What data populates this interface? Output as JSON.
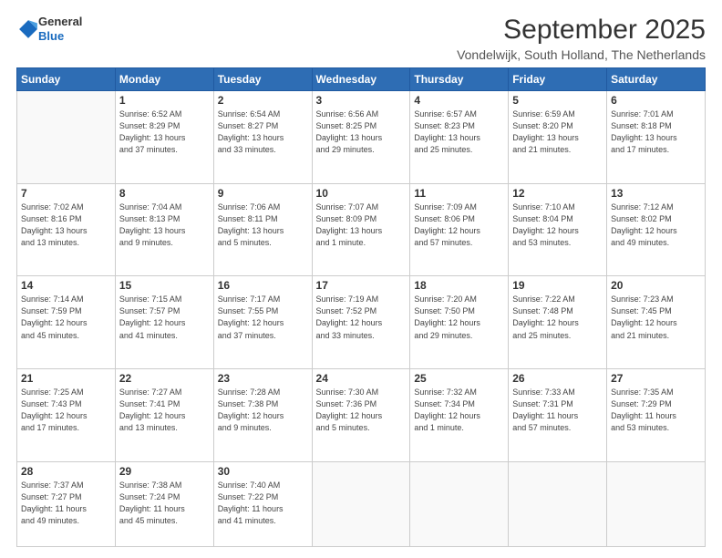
{
  "logo": {
    "general": "General",
    "blue": "Blue"
  },
  "header": {
    "month_year": "September 2025",
    "location": "Vondelwijk, South Holland, The Netherlands"
  },
  "days_of_week": [
    "Sunday",
    "Monday",
    "Tuesday",
    "Wednesday",
    "Thursday",
    "Friday",
    "Saturday"
  ],
  "weeks": [
    [
      {
        "day": "",
        "info": ""
      },
      {
        "day": "1",
        "info": "Sunrise: 6:52 AM\nSunset: 8:29 PM\nDaylight: 13 hours\nand 37 minutes."
      },
      {
        "day": "2",
        "info": "Sunrise: 6:54 AM\nSunset: 8:27 PM\nDaylight: 13 hours\nand 33 minutes."
      },
      {
        "day": "3",
        "info": "Sunrise: 6:56 AM\nSunset: 8:25 PM\nDaylight: 13 hours\nand 29 minutes."
      },
      {
        "day": "4",
        "info": "Sunrise: 6:57 AM\nSunset: 8:23 PM\nDaylight: 13 hours\nand 25 minutes."
      },
      {
        "day": "5",
        "info": "Sunrise: 6:59 AM\nSunset: 8:20 PM\nDaylight: 13 hours\nand 21 minutes."
      },
      {
        "day": "6",
        "info": "Sunrise: 7:01 AM\nSunset: 8:18 PM\nDaylight: 13 hours\nand 17 minutes."
      }
    ],
    [
      {
        "day": "7",
        "info": "Sunrise: 7:02 AM\nSunset: 8:16 PM\nDaylight: 13 hours\nand 13 minutes."
      },
      {
        "day": "8",
        "info": "Sunrise: 7:04 AM\nSunset: 8:13 PM\nDaylight: 13 hours\nand 9 minutes."
      },
      {
        "day": "9",
        "info": "Sunrise: 7:06 AM\nSunset: 8:11 PM\nDaylight: 13 hours\nand 5 minutes."
      },
      {
        "day": "10",
        "info": "Sunrise: 7:07 AM\nSunset: 8:09 PM\nDaylight: 13 hours\nand 1 minute."
      },
      {
        "day": "11",
        "info": "Sunrise: 7:09 AM\nSunset: 8:06 PM\nDaylight: 12 hours\nand 57 minutes."
      },
      {
        "day": "12",
        "info": "Sunrise: 7:10 AM\nSunset: 8:04 PM\nDaylight: 12 hours\nand 53 minutes."
      },
      {
        "day": "13",
        "info": "Sunrise: 7:12 AM\nSunset: 8:02 PM\nDaylight: 12 hours\nand 49 minutes."
      }
    ],
    [
      {
        "day": "14",
        "info": "Sunrise: 7:14 AM\nSunset: 7:59 PM\nDaylight: 12 hours\nand 45 minutes."
      },
      {
        "day": "15",
        "info": "Sunrise: 7:15 AM\nSunset: 7:57 PM\nDaylight: 12 hours\nand 41 minutes."
      },
      {
        "day": "16",
        "info": "Sunrise: 7:17 AM\nSunset: 7:55 PM\nDaylight: 12 hours\nand 37 minutes."
      },
      {
        "day": "17",
        "info": "Sunrise: 7:19 AM\nSunset: 7:52 PM\nDaylight: 12 hours\nand 33 minutes."
      },
      {
        "day": "18",
        "info": "Sunrise: 7:20 AM\nSunset: 7:50 PM\nDaylight: 12 hours\nand 29 minutes."
      },
      {
        "day": "19",
        "info": "Sunrise: 7:22 AM\nSunset: 7:48 PM\nDaylight: 12 hours\nand 25 minutes."
      },
      {
        "day": "20",
        "info": "Sunrise: 7:23 AM\nSunset: 7:45 PM\nDaylight: 12 hours\nand 21 minutes."
      }
    ],
    [
      {
        "day": "21",
        "info": "Sunrise: 7:25 AM\nSunset: 7:43 PM\nDaylight: 12 hours\nand 17 minutes."
      },
      {
        "day": "22",
        "info": "Sunrise: 7:27 AM\nSunset: 7:41 PM\nDaylight: 12 hours\nand 13 minutes."
      },
      {
        "day": "23",
        "info": "Sunrise: 7:28 AM\nSunset: 7:38 PM\nDaylight: 12 hours\nand 9 minutes."
      },
      {
        "day": "24",
        "info": "Sunrise: 7:30 AM\nSunset: 7:36 PM\nDaylight: 12 hours\nand 5 minutes."
      },
      {
        "day": "25",
        "info": "Sunrise: 7:32 AM\nSunset: 7:34 PM\nDaylight: 12 hours\nand 1 minute."
      },
      {
        "day": "26",
        "info": "Sunrise: 7:33 AM\nSunset: 7:31 PM\nDaylight: 11 hours\nand 57 minutes."
      },
      {
        "day": "27",
        "info": "Sunrise: 7:35 AM\nSunset: 7:29 PM\nDaylight: 11 hours\nand 53 minutes."
      }
    ],
    [
      {
        "day": "28",
        "info": "Sunrise: 7:37 AM\nSunset: 7:27 PM\nDaylight: 11 hours\nand 49 minutes."
      },
      {
        "day": "29",
        "info": "Sunrise: 7:38 AM\nSunset: 7:24 PM\nDaylight: 11 hours\nand 45 minutes."
      },
      {
        "day": "30",
        "info": "Sunrise: 7:40 AM\nSunset: 7:22 PM\nDaylight: 11 hours\nand 41 minutes."
      },
      {
        "day": "",
        "info": ""
      },
      {
        "day": "",
        "info": ""
      },
      {
        "day": "",
        "info": ""
      },
      {
        "day": "",
        "info": ""
      }
    ]
  ]
}
